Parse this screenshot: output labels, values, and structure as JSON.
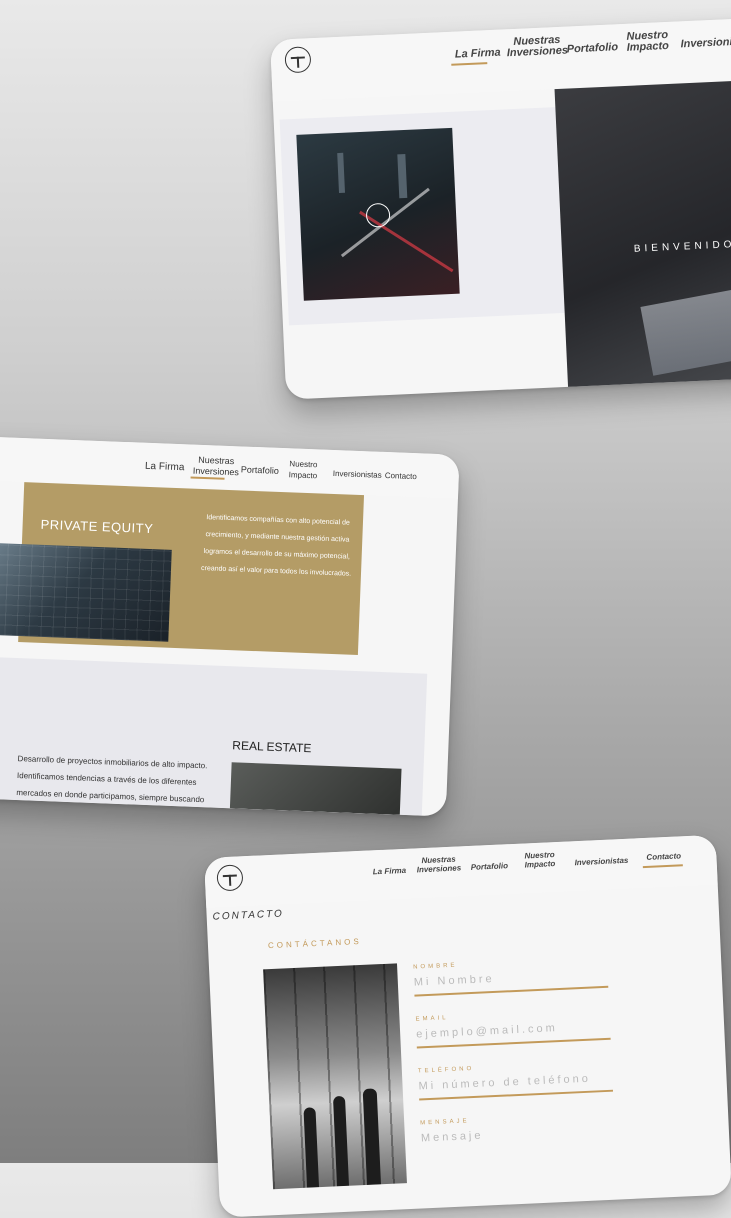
{
  "screen1": {
    "nav": [
      "La Firma",
      "Nuestras\nInversiones",
      "Portafolio",
      "Nuestro\nImpacto",
      "Inversionistas"
    ],
    "hero_text": "BIENVENIDO"
  },
  "screen2": {
    "nav": [
      "La Firma",
      "Nuestras\nInversiones",
      "Portafolio",
      "Nuestro\nImpacto",
      "Inversionistas",
      "Contacto"
    ],
    "private_equity": {
      "title": "PRIVATE EQUITY",
      "lines": [
        "Identificamos compañías con alto potencial de",
        "crecimiento, y mediante nuestra gestión activa",
        "logramos el desarrollo de su máximo potencial,",
        "creando así el valor para todos los involucrados."
      ]
    },
    "real_estate": {
      "title": "REAL ESTATE",
      "lines": [
        "Desarrollo de proyectos inmobiliarios de alto impacto.",
        "Identificamos tendencias a través de los diferentes",
        "mercados en donde participamos, siempre buscando"
      ]
    }
  },
  "screen3": {
    "nav": [
      "La Firma",
      "Nuestras\nInversiones",
      "Portafolio",
      "Nuestro\nImpacto",
      "Inversionistas",
      "Contacto"
    ],
    "page_title": "CONTACTO",
    "section_label": "CONTÁCTANOS",
    "form": {
      "nombre_label": "NOMBRE",
      "nombre_placeholder": "Mi Nombre",
      "email_label": "EMAIL",
      "email_placeholder": "ejemplo@mail.com",
      "telefono_label": "TELÉFONO",
      "telefono_placeholder": "Mi número de teléfono",
      "mensaje_label": "MENSAJE",
      "mensaje_placeholder": "Mensaje"
    }
  },
  "colors": {
    "accent_gold": "#c39a5a",
    "panel_gold": "#b49c66",
    "dark_hero": "#2a2b2f"
  }
}
